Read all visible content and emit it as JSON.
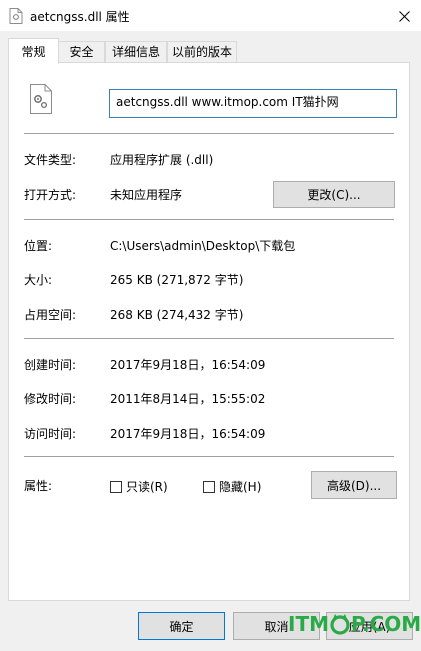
{
  "window": {
    "title": "aetcngss.dll 属性"
  },
  "tabs": [
    {
      "label": "常规"
    },
    {
      "label": "安全"
    },
    {
      "label": "详细信息"
    },
    {
      "label": "以前的版本"
    }
  ],
  "general": {
    "filename": "aetcngss.dll www.itmop.com IT猫扑网",
    "file_type_label": "文件类型:",
    "file_type_value": "应用程序扩展 (.dll)",
    "open_with_label": "打开方式:",
    "open_with_value": "未知应用程序",
    "change_button": "更改(C)...",
    "location_label": "位置:",
    "location_value": "C:\\Users\\admin\\Desktop\\下载包",
    "size_label": "大小:",
    "size_value": "265 KB (271,872 字节)",
    "size_on_disk_label": "占用空间:",
    "size_on_disk_value": "268 KB (274,432 字节)",
    "created_label": "创建时间:",
    "created_value": "2017年9月18日，16:54:09",
    "modified_label": "修改时间:",
    "modified_value": "2011年8月14日，15:55:02",
    "accessed_label": "访问时间:",
    "accessed_value": "2017年9月18日，16:54:09",
    "attributes_label": "属性:",
    "readonly_label": "只读(R)",
    "hidden_label": "隐藏(H)",
    "advanced_button": "高级(D)..."
  },
  "footer": {
    "ok_button": "确定",
    "cancel_button": "取消",
    "apply_button": "应用(A)"
  },
  "watermark": {
    "text_left": "ITM",
    "text_right": "P.COM"
  },
  "colors": {
    "accent": "#0078d7",
    "watermark": "#2aaa46"
  }
}
